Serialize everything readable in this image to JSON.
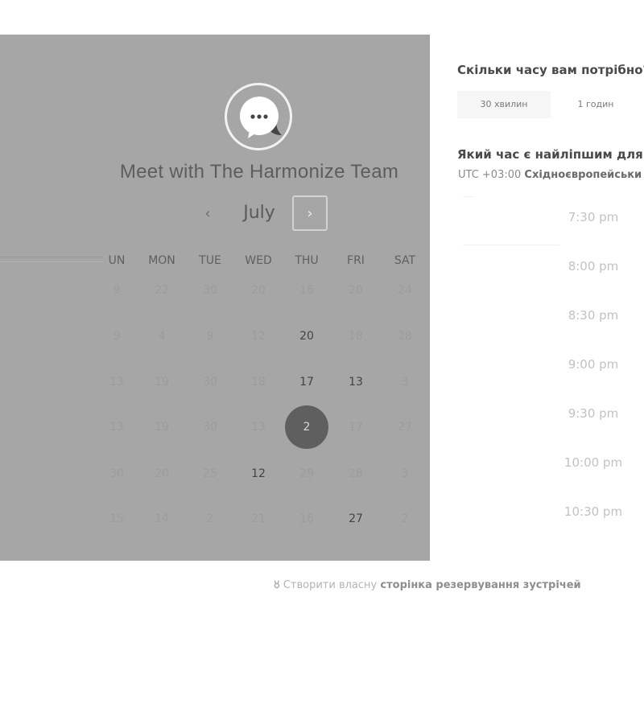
{
  "header": {
    "title": "Meet with The Harmonize Team"
  },
  "calendar": {
    "month": "July",
    "prev_icon": "‹",
    "next_icon": "›",
    "weekdays": [
      "UN",
      "MON",
      "TUE",
      "WED",
      "THU",
      "FRI",
      "SAT"
    ],
    "weeks": [
      [
        "9",
        "22",
        "30",
        "20",
        "16",
        "20",
        "24"
      ],
      [
        "9",
        "4",
        "9",
        "12",
        "20",
        "18",
        "28"
      ],
      [
        "13",
        "19",
        "30",
        "18",
        "17",
        "13",
        "3"
      ],
      [
        "13",
        "19",
        "30",
        "13",
        "2",
        "17",
        "27"
      ],
      [
        "30",
        "20",
        "25",
        "12",
        "29",
        "28",
        "3"
      ],
      [
        "15",
        "14",
        "2",
        "21",
        "16",
        "27",
        "2"
      ]
    ],
    "available": [
      [
        1,
        4
      ],
      [
        2,
        4
      ],
      [
        2,
        5
      ],
      [
        4,
        3
      ],
      [
        5,
        5
      ]
    ],
    "selected": [
      3,
      4
    ]
  },
  "duration": {
    "question": "Скільки часу вам потрібно?",
    "options": [
      "30 хвилин",
      "1 годин"
    ]
  },
  "time": {
    "question": "Який час є найліпшим для в",
    "tz_offset": "UTC +03:00",
    "tz_name": "Східноєвропейськи",
    "slots": [
      "7:30 pm",
      "8:00 pm",
      "8:30 pm",
      "9:00 pm",
      "9:30 pm",
      "10:00 pm",
      "10:30 pm"
    ]
  },
  "footer": {
    "prefix": "Створити власну",
    "link": "сторінка резервування зустрічей"
  },
  "colors": {
    "overlay": "#a6a6a6",
    "selected": "#5f5f5f"
  }
}
